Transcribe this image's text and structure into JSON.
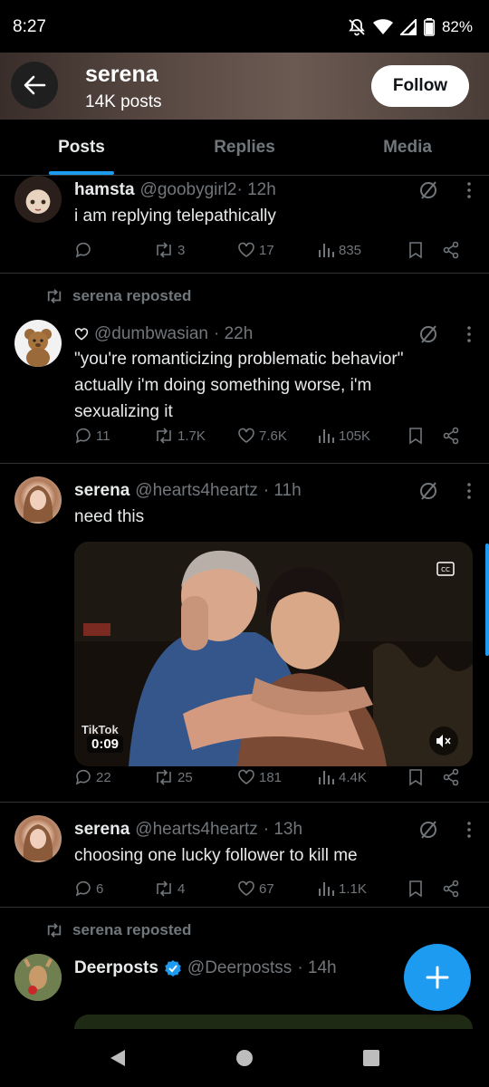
{
  "status_bar": {
    "time": "8:27",
    "battery": "82%"
  },
  "header": {
    "name": "serena",
    "posts_count": "14K posts",
    "follow_label": "Follow"
  },
  "tabs": [
    {
      "label": "Posts",
      "active": true
    },
    {
      "label": "Replies",
      "active": false
    },
    {
      "label": "Media",
      "active": false
    }
  ],
  "posts": [
    {
      "name": "hamsta",
      "handle": "@goobygirl2",
      "time": "· 12h",
      "text": "i am replying telepathically",
      "reply": "",
      "reposts": "3",
      "likes": "17",
      "views": "835"
    },
    {
      "repost_label": "serena reposted",
      "name": "",
      "handle": "@dumbwasian",
      "time": "· 22h",
      "text_lines": [
        "\"you're romanticizing problematic behavior\"",
        "actually i'm doing something worse, i'm",
        "sexualizing it"
      ],
      "reply": "11",
      "reposts": "1.7K",
      "likes": "7.6K",
      "views": "105K"
    },
    {
      "name": "serena",
      "handle": "@hearts4heartz",
      "time": "· 11h",
      "text": "need this",
      "media": {
        "badge": "TikTok",
        "duration": "0:09",
        "cc": "CC"
      },
      "reply": "22",
      "reposts": "25",
      "likes": "181",
      "views": "4.4K"
    },
    {
      "name": "serena",
      "handle": "@hearts4heartz",
      "time": "· 13h",
      "text": "choosing one lucky follower to kill me",
      "reply": "6",
      "reposts": "4",
      "likes": "67",
      "views": "1.1K"
    },
    {
      "repost_label": "serena reposted",
      "name": "Deerposts",
      "handle": "@Deerpostss",
      "time": "· 14h"
    }
  ],
  "colors": {
    "accent": "#1d9bf0",
    "muted": "#71767b",
    "text": "#e7e9ea",
    "divider": "#2f3336"
  }
}
